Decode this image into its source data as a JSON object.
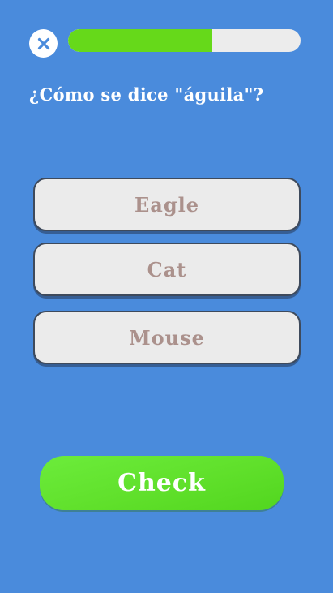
{
  "colors": {
    "background": "#4a8bdc",
    "progress_fill": "#66d91a",
    "progress_track": "#ececec",
    "option_bg": "#ebebeb",
    "option_text": "#ab918c",
    "check_button": "#60e02b"
  },
  "header": {
    "close_icon": "close-icon",
    "progress_fraction": 0.62
  },
  "question": {
    "text": "¿Cómo se dice \"águila\"?"
  },
  "options": [
    {
      "label": "Eagle"
    },
    {
      "label": "Cat"
    },
    {
      "label": "Mouse"
    }
  ],
  "footer": {
    "check_label": "Check"
  }
}
